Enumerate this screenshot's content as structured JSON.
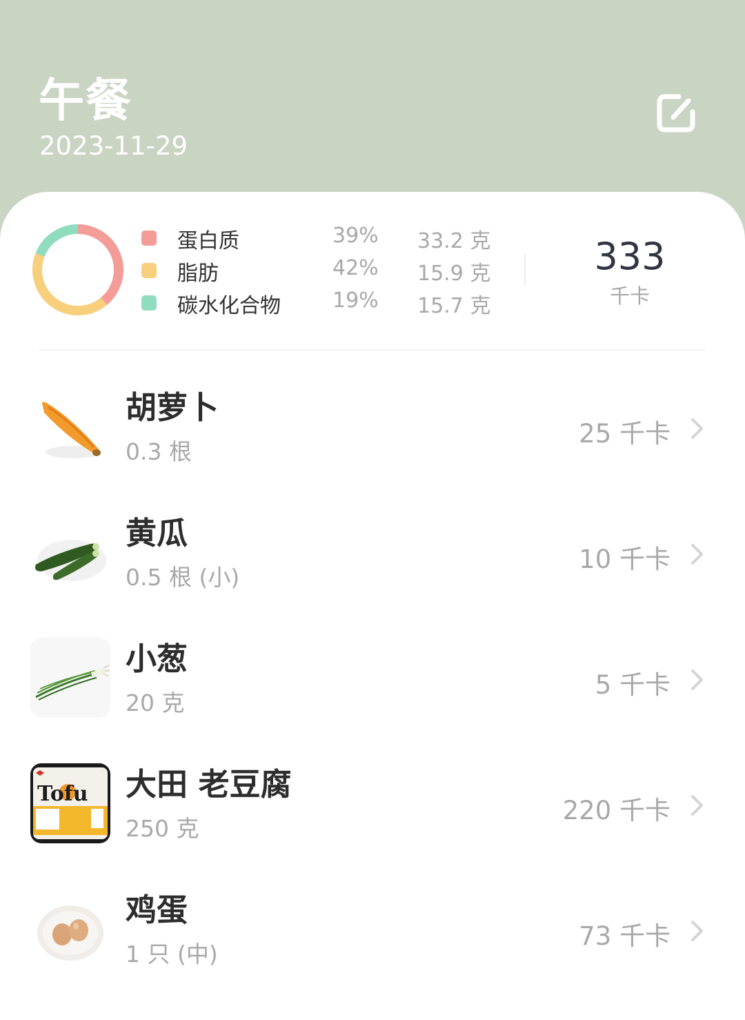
{
  "meal": {
    "title": "午餐",
    "date": "2023-11-29"
  },
  "edit_icon": "edit-icon",
  "nutrition": {
    "items": [
      {
        "name": "蛋白质",
        "percent": "39%",
        "amount": "33.2 克",
        "color": "#f49c97"
      },
      {
        "name": "脂肪",
        "percent": "42%",
        "amount": "15.9 克",
        "color": "#f8cf7d"
      },
      {
        "name": "碳水化合物",
        "percent": "19%",
        "amount": "15.7 克",
        "color": "#8fdcbf"
      }
    ],
    "donut_fractions": [
      0.39,
      0.42,
      0.19
    ],
    "total_value": "333",
    "total_unit": "千卡"
  },
  "foods": [
    {
      "name": "胡萝卜",
      "amount": "0.3 根",
      "kcal": "25 千卡",
      "icon": "carrot-icon"
    },
    {
      "name": "黄瓜",
      "amount": "0.5 根 (小)",
      "kcal": "10 千卡",
      "icon": "cucumber-icon"
    },
    {
      "name": "小葱",
      "amount": "20 克",
      "kcal": "5 千卡",
      "icon": "scallion-icon"
    },
    {
      "name": "大田 老豆腐",
      "amount": "250 克",
      "kcal": "220 千卡",
      "icon": "tofu-package-icon",
      "package_label": "Tofu"
    },
    {
      "name": "鸡蛋",
      "amount": "1 只 (中)",
      "kcal": "73 千卡",
      "icon": "egg-icon"
    }
  ],
  "colors": {
    "header_bg": "#c9d4c3",
    "card_bg": "#ffffff",
    "text_primary": "#2d2d2d",
    "text_secondary": "#a8a8a8"
  }
}
